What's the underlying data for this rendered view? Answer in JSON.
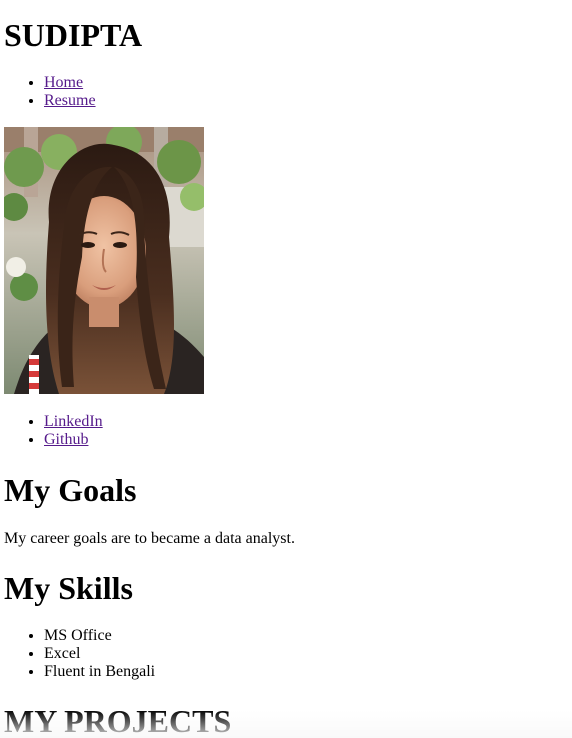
{
  "site": {
    "title": "SUDIPTA"
  },
  "nav": {
    "items": [
      {
        "label": "Home"
      },
      {
        "label": "Resume"
      }
    ]
  },
  "profile": {
    "photo_alt": "Portrait photo of Sudipta"
  },
  "social": {
    "items": [
      {
        "label": "LinkedIn"
      },
      {
        "label": "Github"
      }
    ]
  },
  "goals": {
    "heading": "My Goals",
    "text": "My career goals are to became a data analyst."
  },
  "skills": {
    "heading": "My Skills",
    "items": [
      "MS Office",
      "Excel",
      "Fluent in Bengali"
    ]
  },
  "projects": {
    "heading": "MY PROJECTS"
  },
  "colors": {
    "link": "#551a8b",
    "text": "#000000",
    "background": "#ffffff"
  }
}
